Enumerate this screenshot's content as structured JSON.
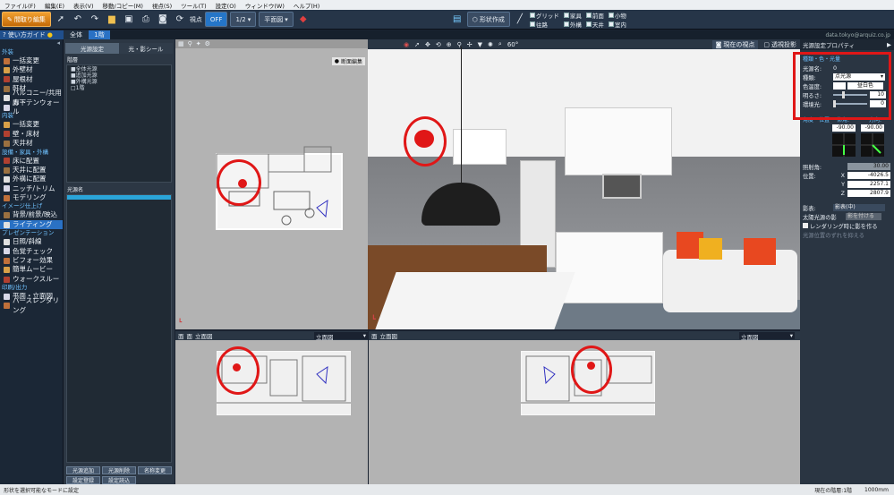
{
  "menu": [
    "ファイル(F)",
    "編集(E)",
    "表示(V)",
    "移動/コピー(M)",
    "視点(S)",
    "ツール(T)",
    "設定(O)",
    "ウィンドウ(W)",
    "ヘルプ(H)"
  ],
  "toolbar": {
    "mode_button": "間取り編集",
    "view_label": "視点",
    "view_toggle": "OFF",
    "scale": "1/2",
    "plan_select": "平面図",
    "shape_label": "形状作成",
    "checks": [
      [
        "グリッド",
        "往路"
      ],
      [
        "家具",
        "外構"
      ],
      [
        "前面",
        "天井"
      ],
      [
        "小物",
        "室内"
      ]
    ]
  },
  "row3": {
    "help": "使い方ガイド",
    "tabs": [
      "全体",
      "1階"
    ],
    "account": "data.tokyo@arquiz.co.jp"
  },
  "nav": {
    "groups": [
      {
        "title": "外装",
        "items": [
          "一括変更",
          "外壁材",
          "屋根材",
          "軒材",
          "バルコニー/共用廊下",
          "カーテンウォール"
        ]
      },
      {
        "title": "内装",
        "items": [
          "一括変更",
          "壁・床材",
          "天井材"
        ]
      },
      {
        "title": "設備・家具・外構",
        "items": [
          "床に配置",
          "天井に配置",
          "外構に配置",
          "ニッチ/トリム",
          "モデリング"
        ]
      },
      {
        "title": "イメージ仕上げ",
        "items": [
          "背景/前景/映込",
          "ライティング"
        ]
      },
      {
        "title": "プレゼンテーション",
        "items": [
          "日照/斜線",
          "色覚チェック",
          "ビフォー効果",
          "簡単ムービー",
          "ウォークスルー"
        ]
      },
      {
        "title": "印刷/出力",
        "items": [
          "平面・立面図",
          "パースレンダリング"
        ]
      }
    ],
    "selected": "ライティング"
  },
  "left_panel": {
    "tabs": [
      "光源設定",
      "光・影シール"
    ],
    "tree_label": "階層",
    "tree": [
      "■全体光源",
      "■追加光源",
      "■外構光源",
      "□1階"
    ],
    "list_label": "光源名",
    "buttons": [
      [
        "光源追加",
        "光源削除",
        "名称変更"
      ],
      [
        "設定登録",
        "設定読込"
      ]
    ]
  },
  "viewports": {
    "top_left": {
      "button": "断面編集"
    },
    "bottom_left": {
      "tabs": [
        "面",
        "面",
        "立面図"
      ],
      "select": "立面図"
    },
    "bottom_right": {
      "tabs": [
        "面",
        "立面図"
      ],
      "select": "立面図"
    },
    "perspective": {
      "view_button": "現在の視点",
      "mode_button": "透視投影",
      "angle": "60°"
    }
  },
  "props": {
    "title": "光源設定プロパティ",
    "section": "種類・色・光量",
    "name_label": "光源名:",
    "name_value": "0",
    "type_label": "種類:",
    "type_value": "点光源",
    "temp_label": "色温度:",
    "temp_value": "昼白色",
    "brightness_label": "明るさ:",
    "brightness_value": "10",
    "spread_label": "環境光:",
    "spread_value": "0",
    "angle_section": "角度・位置",
    "tilt_label": "仰角:",
    "tilt_value": "-90.00",
    "dir_label": "方向:",
    "dir_value": "-90.00",
    "spot_label": "照射角:",
    "spot_value": "30.00",
    "pos_label": "位置:",
    "x": "-4026.5",
    "y": "2257.1",
    "z": "2807.9",
    "shadow_label": "影表:",
    "shadow_value": "影表(中)",
    "sun_label": "太陽光源の影",
    "sun_value": "影を付ける",
    "render_check": "レンダリング時に影を作る",
    "lock_label": "光源位置のずれを抑える"
  },
  "status": {
    "left": "形状を選択可能なモードに設定",
    "right1": "現在の階層:1階",
    "right2": "1000mm"
  },
  "colors": {
    "accent": "#2a71c4",
    "highlight": "#e01717"
  }
}
